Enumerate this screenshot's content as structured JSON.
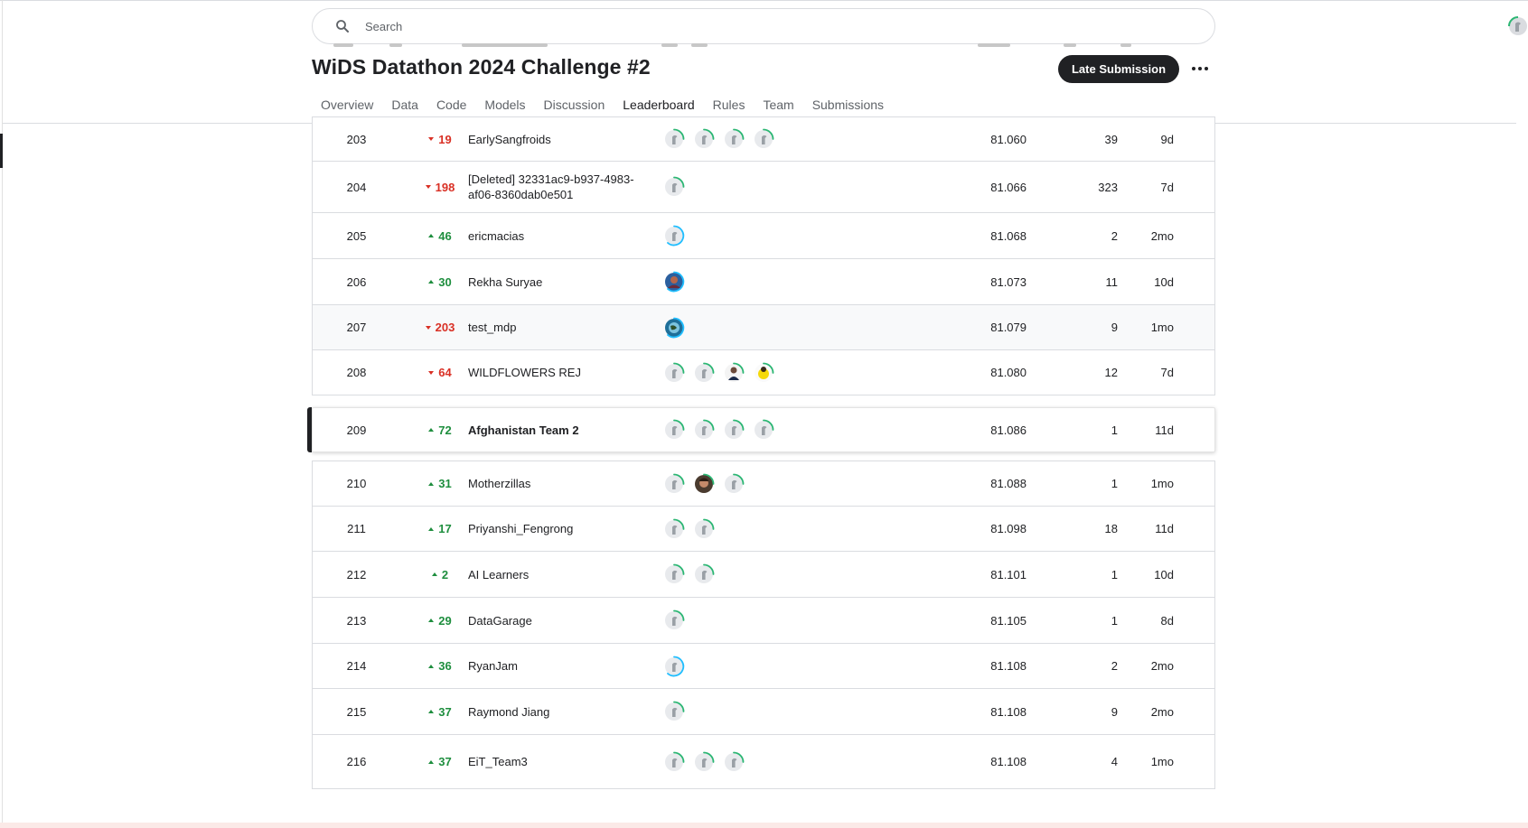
{
  "search": {
    "placeholder": "Search"
  },
  "competition": {
    "title": "WiDS Datathon 2024 Challenge #2",
    "late_submission_label": "Late Submission"
  },
  "tabs": [
    {
      "label": "Overview",
      "active": false
    },
    {
      "label": "Data",
      "active": false
    },
    {
      "label": "Code",
      "active": false
    },
    {
      "label": "Models",
      "active": false
    },
    {
      "label": "Discussion",
      "active": false
    },
    {
      "label": "Leaderboard",
      "active": true
    },
    {
      "label": "Rules",
      "active": false
    },
    {
      "label": "Team",
      "active": false
    },
    {
      "label": "Submissions",
      "active": false
    }
  ],
  "colors": {
    "accent": "#202124",
    "up": "#1e8e3e",
    "down": "#d93025",
    "tier_ring_green": "#20beff",
    "ring_green": "#2bb673"
  },
  "leaderboard": {
    "rows": [
      {
        "rank": "203",
        "direction": "down",
        "change": "19",
        "team": "EarlySangfroids",
        "members": [
          "default-avatar",
          "default-avatar",
          "default-avatar",
          "default-avatar"
        ],
        "score": "81.060",
        "entries": "39",
        "last": "9d"
      },
      {
        "rank": "204",
        "direction": "down",
        "change": "198",
        "team": "[Deleted] 32331ac9-b937-4983-af06-8360dab0e501",
        "members": [
          "default-avatar"
        ],
        "score": "81.066",
        "entries": "323",
        "last": "7d"
      },
      {
        "rank": "205",
        "direction": "up",
        "change": "46",
        "team": "ericmacias",
        "members": [
          "default-avatar-blue"
        ],
        "score": "81.068",
        "entries": "2",
        "last": "2mo"
      },
      {
        "rank": "206",
        "direction": "up",
        "change": "30",
        "team": "Rekha Suryae",
        "members": [
          "photo-avatar-blue"
        ],
        "score": "81.073",
        "entries": "11",
        "last": "10d"
      },
      {
        "rank": "207",
        "direction": "down",
        "change": "203",
        "team": "test_mdp",
        "members": [
          "photo-avatar-globe"
        ],
        "score": "81.079",
        "entries": "9",
        "last": "1mo",
        "hover": true
      },
      {
        "rank": "208",
        "direction": "down",
        "change": "64",
        "team": "WILDFLOWERS REJ",
        "members": [
          "default-avatar",
          "default-avatar",
          "photo-avatar-person",
          "photo-avatar-yellow"
        ],
        "score": "81.080",
        "entries": "12",
        "last": "7d"
      },
      {
        "rank": "209",
        "direction": "up",
        "change": "72",
        "team": "Afghanistan Team 2",
        "members": [
          "default-avatar",
          "default-avatar",
          "default-avatar",
          "default-avatar"
        ],
        "score": "81.086",
        "entries": "1",
        "last": "11d",
        "mine": true
      },
      {
        "rank": "210",
        "direction": "up",
        "change": "31",
        "team": "Motherzillas",
        "members": [
          "default-avatar",
          "photo-avatar-face",
          "default-avatar"
        ],
        "score": "81.088",
        "entries": "1",
        "last": "1mo"
      },
      {
        "rank": "211",
        "direction": "up",
        "change": "17",
        "team": "Priyanshi_Fengrong",
        "members": [
          "default-avatar",
          "default-avatar"
        ],
        "score": "81.098",
        "entries": "18",
        "last": "11d"
      },
      {
        "rank": "212",
        "direction": "up",
        "change": "2",
        "team": "AI Learners",
        "members": [
          "default-avatar",
          "default-avatar"
        ],
        "score": "81.101",
        "entries": "1",
        "last": "10d"
      },
      {
        "rank": "213",
        "direction": "up",
        "change": "29",
        "team": "DataGarage",
        "members": [
          "default-avatar"
        ],
        "score": "81.105",
        "entries": "1",
        "last": "8d"
      },
      {
        "rank": "214",
        "direction": "up",
        "change": "36",
        "team": "RyanJam",
        "members": [
          "default-avatar-blue"
        ],
        "score": "81.108",
        "entries": "2",
        "last": "2mo"
      },
      {
        "rank": "215",
        "direction": "up",
        "change": "37",
        "team": "Raymond Jiang",
        "members": [
          "default-avatar"
        ],
        "score": "81.108",
        "entries": "9",
        "last": "2mo"
      },
      {
        "rank": "216",
        "direction": "up",
        "change": "37",
        "team": "EiT_Team3",
        "members": [
          "default-avatar",
          "default-avatar",
          "default-avatar"
        ],
        "score": "81.108",
        "entries": "4",
        "last": "1mo"
      }
    ]
  }
}
